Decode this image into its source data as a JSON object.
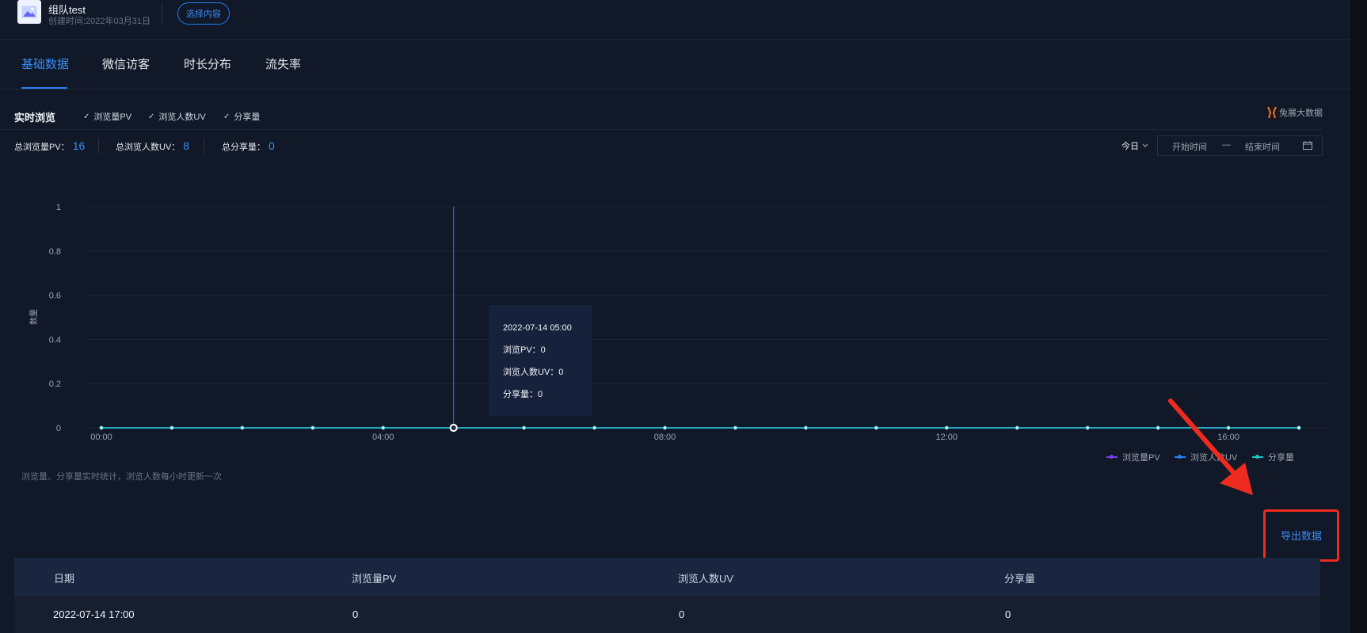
{
  "project": {
    "name": "组队test",
    "created": "创建时间:2022年03月31日",
    "select_button": "选择内容"
  },
  "tabs": [
    "基础数据",
    "微信访客",
    "时长分布",
    "流失率"
  ],
  "realtime": {
    "title": "实时浏览",
    "checkboxes": [
      "浏览量PV",
      "浏览人数UV",
      "分享量"
    ],
    "logo_text": "兔展大数据"
  },
  "stats": [
    {
      "label": "总浏览量PV：",
      "value": "16"
    },
    {
      "label": "总浏览人数UV：",
      "value": "8"
    },
    {
      "label": "总分享量：",
      "value": "0"
    }
  ],
  "date_filter": {
    "period": "今日",
    "start_placeholder": "开始时间",
    "separator": "—",
    "end_placeholder": "结束时间"
  },
  "chart_data": {
    "type": "line",
    "ylabel": "数量",
    "ylim": [
      0,
      1
    ],
    "y_ticks": [
      "1",
      "0.8",
      "0.6",
      "0.4",
      "0.2",
      "0"
    ],
    "x_ticks": [
      "00:00",
      "04:00",
      "08:00",
      "12:00",
      "16:00"
    ],
    "x": [
      "00:00",
      "01:00",
      "02:00",
      "03:00",
      "04:00",
      "05:00",
      "06:00",
      "07:00",
      "08:00",
      "09:00",
      "10:00",
      "11:00",
      "12:00",
      "13:00",
      "14:00",
      "15:00",
      "16:00",
      "17:00"
    ],
    "series": [
      {
        "name": "浏览量PV",
        "color": "#7c3aed",
        "values": [
          0,
          0,
          0,
          0,
          0,
          0,
          0,
          0,
          0,
          0,
          0,
          0,
          0,
          0,
          0,
          0,
          0,
          0
        ]
      },
      {
        "name": "浏览人数UV",
        "color": "#2b7ff2",
        "values": [
          0,
          0,
          0,
          0,
          0,
          0,
          0,
          0,
          0,
          0,
          0,
          0,
          0,
          0,
          0,
          0,
          0,
          0
        ]
      },
      {
        "name": "分享量",
        "color": "#22c5c0",
        "values": [
          0,
          0,
          0,
          0,
          0,
          0,
          0,
          0,
          0,
          0,
          0,
          0,
          0,
          0,
          0,
          0,
          0,
          0
        ]
      }
    ],
    "highlight_index": 5,
    "tooltip": {
      "title": "2022-07-14 05:00",
      "lines": [
        "浏览PV：0",
        "浏览人数UV：0",
        "分享量：0"
      ]
    },
    "legend_position": "bottom-right"
  },
  "footnote": "浏览量、分享量实时统计，浏览人数每小时更新一次",
  "export_label": "导出数据",
  "table": {
    "headers": [
      "日期",
      "浏览量PV",
      "浏览人数UV",
      "分享量"
    ],
    "rows": [
      [
        "2022-07-14 17:00",
        "0",
        "0",
        "0"
      ]
    ]
  },
  "colors": {
    "accent": "#3b8cf5",
    "background": "#111827",
    "annotation": "#ef2b20"
  }
}
